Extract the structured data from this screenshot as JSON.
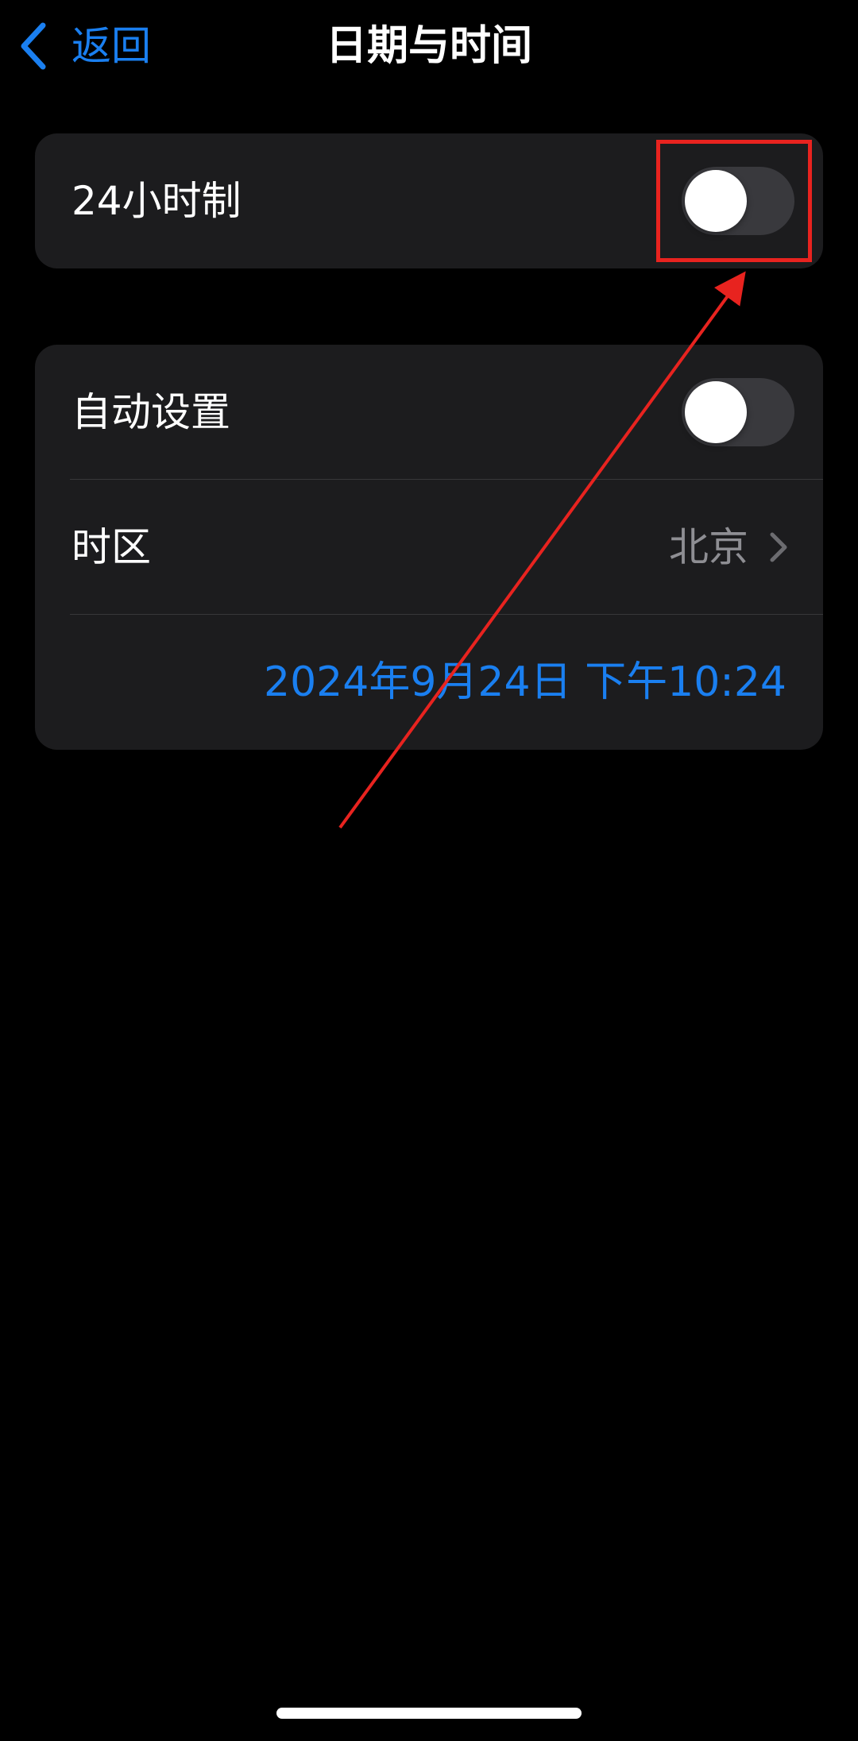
{
  "nav": {
    "back_label": "返回",
    "title": "日期与时间"
  },
  "settings": {
    "hour24": {
      "label": "24小时制",
      "enabled": false
    },
    "auto_set": {
      "label": "自动设置",
      "enabled": false
    },
    "timezone": {
      "label": "时区",
      "value": "北京"
    },
    "datetime": "2024年9月24日  下午10:24"
  },
  "colors": {
    "accent": "#1a7ff0",
    "background": "#000000",
    "card": "#1c1c1e",
    "toggle_off": "#39393d",
    "secondary_text": "#8e8e93",
    "annotation": "#e8231f"
  },
  "icons": {
    "back": "chevron-left-icon",
    "disclosure": "chevron-right-icon"
  }
}
